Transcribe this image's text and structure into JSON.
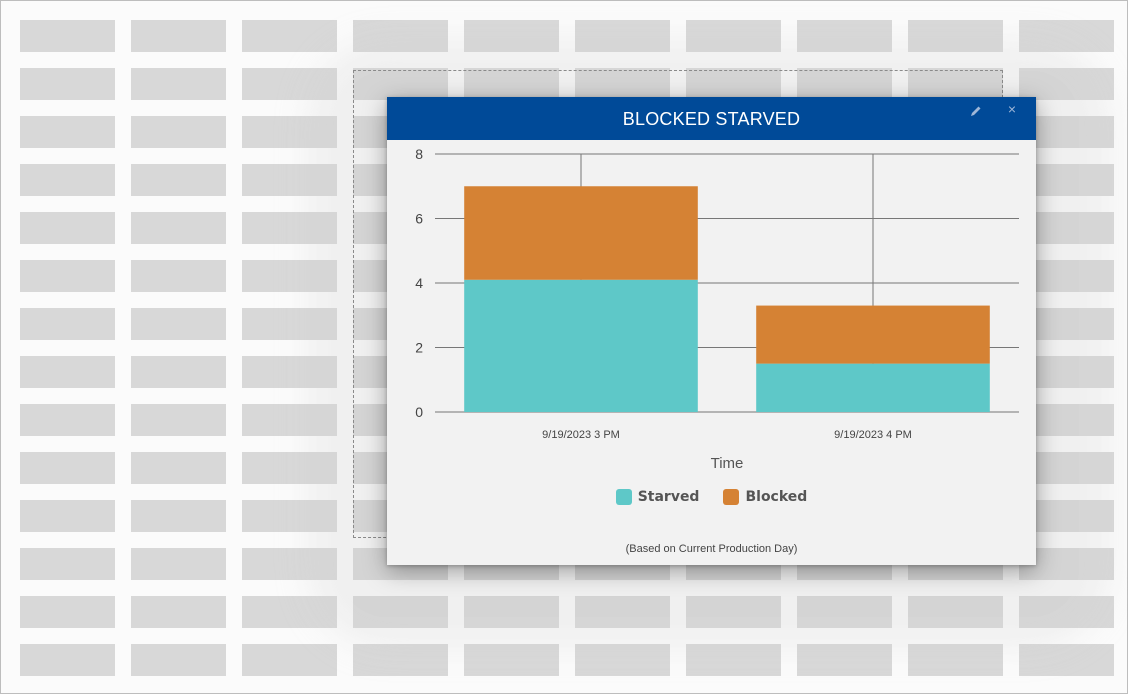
{
  "dialog": {
    "title": "BLOCKED STARVED",
    "footnote": "(Based on Current Production Day)",
    "edit_icon": "pencil-icon",
    "close_icon": "close-icon"
  },
  "chart_data": {
    "type": "bar",
    "stacked": true,
    "categories": [
      "9/19/2023 3 PM",
      "9/19/2023 4 PM"
    ],
    "series": [
      {
        "name": "Starved",
        "values": [
          4.1,
          1.5
        ],
        "color": "#5ec8c8"
      },
      {
        "name": "Blocked",
        "values": [
          2.9,
          1.8
        ],
        "color": "#d58234"
      }
    ],
    "xlabel": "Time",
    "ylabel": "",
    "ylim": [
      0,
      8
    ],
    "yticks": [
      0,
      2,
      4,
      6,
      8
    ],
    "grid": true,
    "legend_position": "bottom"
  },
  "colors": {
    "header": "#004a98",
    "dialog_bg": "#f2f2f2",
    "placeholder_cell": "#d8d8d8"
  }
}
